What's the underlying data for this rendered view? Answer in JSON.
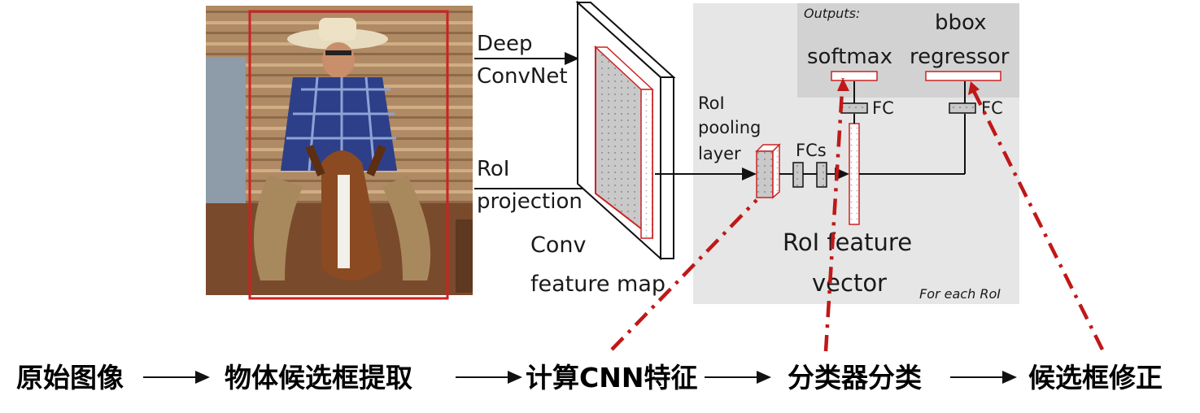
{
  "top_labels": {
    "deep_convnet_1": "Deep",
    "deep_convnet_2": "ConvNet",
    "roi_projection_1": "RoI",
    "roi_projection_2": "projection",
    "conv_map_1": "Conv",
    "conv_map_2": "feature map",
    "roi_pool_1": "RoI",
    "roi_pool_2": "pooling",
    "roi_pool_3": "layer",
    "fcs": "FCs",
    "fc_left": "FC",
    "fc_right": "FC",
    "outputs": "Outputs:",
    "softmax": "softmax",
    "bbox_1": "bbox",
    "bbox_2": "regressor",
    "feat_vec_1": "RoI feature",
    "feat_vec_2": "vector",
    "for_each": "For each RoI"
  },
  "pipeline": {
    "step1": "原始图像",
    "step2": "物体候选框提取",
    "step3": "计算CNN特征",
    "step4": "分类器分类",
    "step5": "候选框修正"
  },
  "colors": {
    "proposal_red": "#cc2222",
    "dash_red": "#c01818",
    "head_panel": "#e6e6e6",
    "output_panel": "#d2d2d2"
  }
}
